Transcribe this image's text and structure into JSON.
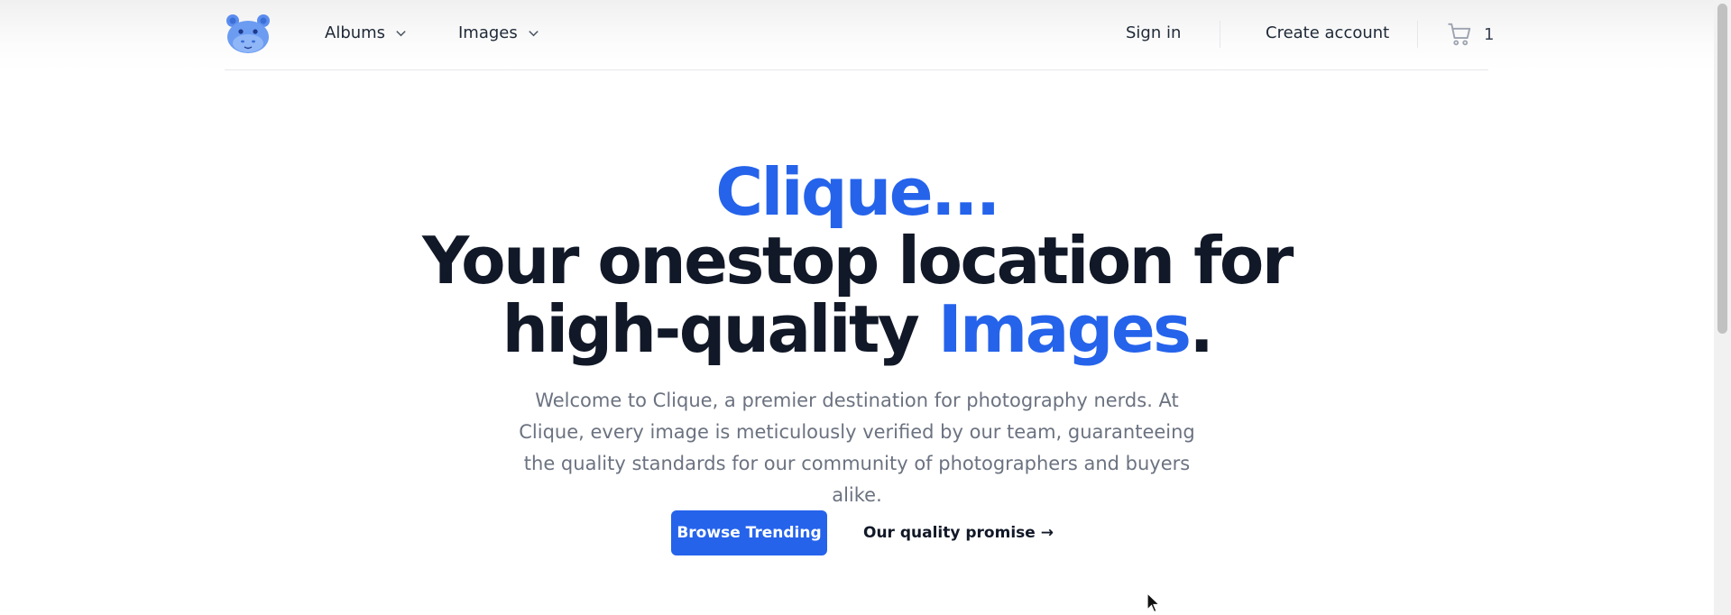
{
  "nav": {
    "albums_label": "Albums",
    "images_label": "Images",
    "sign_in": "Sign in",
    "create_account": "Create account",
    "cart_count": "1"
  },
  "hero": {
    "brand": "Clique...",
    "line2": "Your onestop location for",
    "line3_text": "high-quality ",
    "line3_highlight": "Images",
    "line3_end": ".",
    "description": "Welcome to Clique, a premier destination for photography nerds. At Clique, every image is meticulously verified by our team, guaranteeing the quality standards for our community of photographers and buyers alike.",
    "primary_button": "Browse Trending",
    "secondary_link": "Our quality promise →"
  },
  "colors": {
    "accent": "#2563eb",
    "heading": "#111827",
    "muted": "#6b7280"
  },
  "icons": [
    "hippo-logo-icon",
    "chevron-down-icon",
    "cart-icon",
    "mouse-cursor-icon"
  ]
}
